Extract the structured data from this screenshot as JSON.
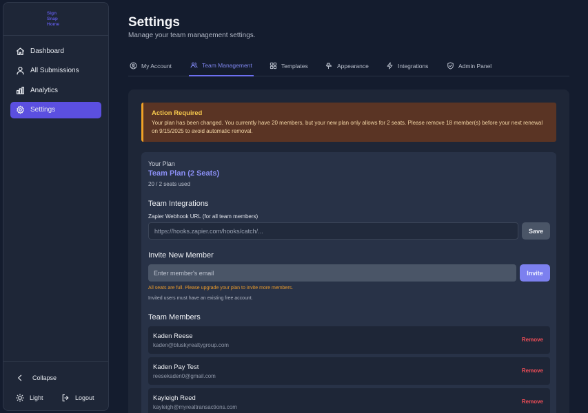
{
  "brand": {
    "line1": "Sign",
    "line2": "Snap",
    "line3": "Home",
    "color": "#5b57d9"
  },
  "sidebar": {
    "items": [
      {
        "label": "Dashboard",
        "icon": "home-icon"
      },
      {
        "label": "All Submissions",
        "icon": "user-icon"
      },
      {
        "label": "Analytics",
        "icon": "bar-chart-icon"
      },
      {
        "label": "Settings",
        "icon": "gear-icon",
        "active": true
      }
    ],
    "collapse_label": "Collapse",
    "theme_label": "Light",
    "logout_label": "Logout"
  },
  "header": {
    "title": "Settings",
    "subtitle": "Manage your team management settings."
  },
  "tabs": [
    {
      "label": "My Account",
      "icon": "user-circle-icon"
    },
    {
      "label": "Team Management",
      "icon": "team-icon",
      "active": true
    },
    {
      "label": "Templates",
      "icon": "grid-icon"
    },
    {
      "label": "Appearance",
      "icon": "paint-icon"
    },
    {
      "label": "Integrations",
      "icon": "lightning-icon"
    },
    {
      "label": "Admin Panel",
      "icon": "shield-icon"
    }
  ],
  "alert": {
    "title": "Action Required",
    "message": "Your plan has been changed. You currently have 20 members, but your new plan only allows for 2 seats. Please remove 18 member(s) before your next renewal on 9/15/2025 to avoid automatic removal."
  },
  "plan": {
    "heading": "Your Plan",
    "name": "Team Plan (2 Seats)",
    "seats_used": "20 / 2 seats used"
  },
  "integrations": {
    "heading": "Team Integrations",
    "webhook_label": "Zapier Webhook URL (for all team members)",
    "webhook_placeholder": "https://hooks.zapier.com/hooks/catch/...",
    "save_label": "Save"
  },
  "invite": {
    "heading": "Invite New Member",
    "email_placeholder": "Enter member's email",
    "button_label": "Invite",
    "warning": "All seats are full. Please upgrade your plan to invite more members.",
    "hint": "Invited users must have an existing free account."
  },
  "members": {
    "heading": "Team Members",
    "remove_label": "Remove",
    "list": [
      {
        "name": "Kaden Reese",
        "email": "kaden@bluskyrealtygroup.com"
      },
      {
        "name": "Kaden Pay Test",
        "email": "reesekaden0@gmail.com"
      },
      {
        "name": "Kayleigh Reed",
        "email": "kayleigh@myrealtransactions.com"
      }
    ]
  },
  "colors": {
    "accent": "#5b4fe0",
    "warning": "#f0a126",
    "danger": "#ef4d57"
  }
}
